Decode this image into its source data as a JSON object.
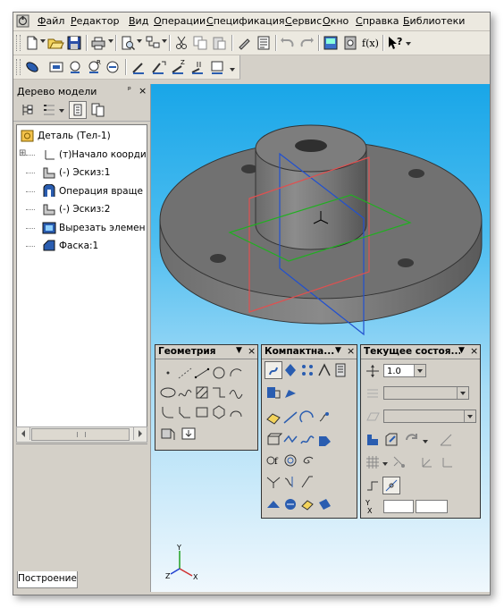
{
  "menu": [
    "Файл",
    "Редактор",
    "Вид",
    "Операции",
    "Спецификация",
    "Сервис",
    "Окно",
    "Справка",
    "Библиотеки"
  ],
  "toolbar_standard": [
    "new-icon",
    "open-icon",
    "save-icon",
    "print-icon",
    "preview-icon",
    "cut-icon",
    "copy-icon",
    "paste-icon",
    "format-painter-icon",
    "properties-icon",
    "undo-icon",
    "redo-icon",
    "manager-icon",
    "library-icon",
    "variables-icon",
    "help-pointer-icon"
  ],
  "toolbar_view": [
    "rotate-icon",
    "zoom-window-icon",
    "zoom-icon",
    "zoom-previous-icon",
    "zoom-next-icon",
    "pan-icon",
    "refresh-icon",
    "orient-icon"
  ],
  "variables_label": "f(x)",
  "panel": {
    "title": "Дерево модели",
    "pin": "ᵖ",
    "close": "×",
    "tab": "Построение"
  },
  "tree": [
    {
      "label": "Деталь (Тел-1)",
      "icon": "part-icon",
      "indent": 0
    },
    {
      "label": "(т)Начало коорди",
      "icon": "origin-icon",
      "indent": 1
    },
    {
      "label": "(-) Эскиз:1",
      "icon": "sketch-icon",
      "indent": 1
    },
    {
      "label": "Операция враще",
      "icon": "revolve-icon",
      "indent": 1
    },
    {
      "label": "(-) Эскиз:2",
      "icon": "sketch-icon",
      "indent": 1
    },
    {
      "label": "Вырезать элемен",
      "icon": "cut-extrude-icon",
      "indent": 1
    },
    {
      "label": "Фаска:1",
      "icon": "chamfer-icon",
      "indent": 1
    }
  ],
  "panels": {
    "geometry": {
      "title": "Геометрия"
    },
    "compact": {
      "title": "Компактна..."
    },
    "state": {
      "title": "Текущее состоя...",
      "step_value": "1.0"
    }
  },
  "axis": {
    "x": "X",
    "y": "Y",
    "z": "Z"
  },
  "colors": {
    "viewport_top": "#19a6e8",
    "viewport_bottom": "#f0f8fd",
    "model_gray": "#6e6e6e",
    "plane_red": "#e05050",
    "plane_green": "#20b020",
    "plane_blue": "#2050d0"
  }
}
